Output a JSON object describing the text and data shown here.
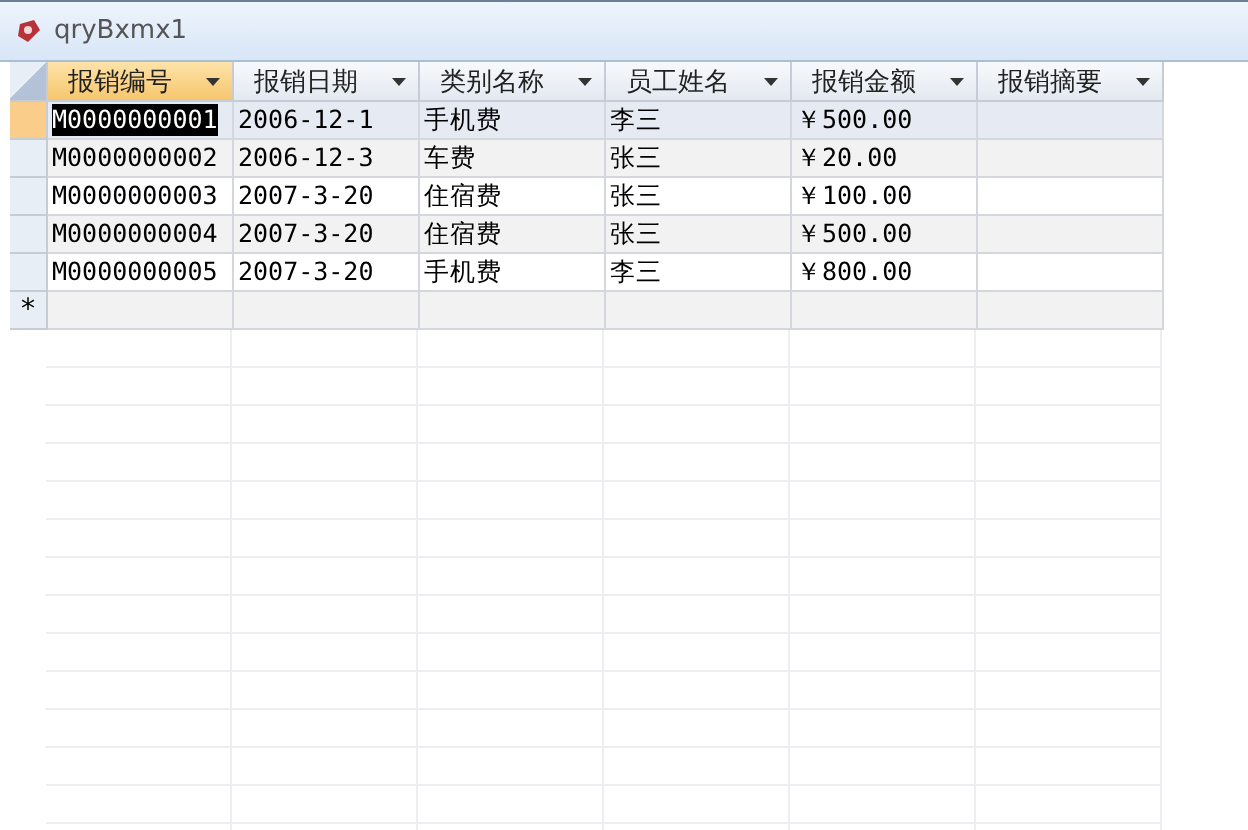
{
  "window": {
    "title": "qryBxmx1"
  },
  "columns": [
    {
      "label": "报销编号",
      "selected": true
    },
    {
      "label": "报销日期",
      "selected": false
    },
    {
      "label": "类别名称",
      "selected": false
    },
    {
      "label": "员工姓名",
      "selected": false
    },
    {
      "label": "报销金额",
      "selected": false
    },
    {
      "label": "报销摘要",
      "selected": false
    }
  ],
  "rows": [
    {
      "selected": true,
      "cells": [
        "M0000000001",
        "2006-12-1",
        "手机费",
        "李三",
        "￥500.00"
      ]
    },
    {
      "selected": false,
      "cells": [
        "M0000000002",
        "2006-12-3",
        "车费",
        "张三",
        "￥20.00"
      ]
    },
    {
      "selected": false,
      "cells": [
        "M0000000003",
        "2007-3-20",
        "住宿费",
        "张三",
        "￥100.00"
      ]
    },
    {
      "selected": false,
      "cells": [
        "M0000000004",
        "2007-3-20",
        "住宿费",
        "张三",
        "￥500.00"
      ]
    },
    {
      "selected": false,
      "cells": [
        "M0000000005",
        "2007-3-20",
        "手机费",
        "李三",
        "￥800.00"
      ]
    }
  ],
  "new_row_marker": "*"
}
